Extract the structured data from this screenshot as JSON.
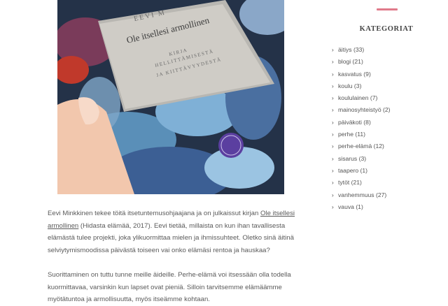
{
  "article": {
    "image": {
      "book_author": "EEVI M",
      "book_title": "Ole itsellesi armollinen",
      "book_subtitle_1": "KIRJA",
      "book_subtitle_2": "HELLITTÄMISESTÄ",
      "book_subtitle_3": "JA KIITTÄVYYDESTÄ"
    },
    "p1": {
      "before": "Eevi Minkkinen tekee töitä itsetuntemusohjaajana ja on julkaissut kirjan ",
      "link": "Ole itsellesi armollinen",
      "after": " (Hidasta elämää, 2017). Eevi tietää, millaista on kun ihan tavallisesta elämästä tulee projekti, joka ylikuormittaa mielen ja ihmissuhteet. Oletko sinä äitinä selviytymismoodissa päivästä toiseen vai onko elämäsi rentoa ja hauskaa?"
    },
    "p2": "Suorittaminen on tuttu tunne meille äideille. Perhe-elämä voi itsessään olla todella kuormittavaa, varsinkin kun lapset ovat pieniä. Silloin tarvitsemme elämäämme myötätuntoa ja armollisuutta, myös itseämme kohtaan."
  },
  "sidebar": {
    "accent_color": "#e07a8a",
    "title": "KATEGORIAT",
    "chevron": "›",
    "categories": [
      {
        "label": "äitiys (33)"
      },
      {
        "label": "blogi (21)"
      },
      {
        "label": "kasvatus (9)"
      },
      {
        "label": "koulu (3)"
      },
      {
        "label": "koululainen (7)"
      },
      {
        "label": "mainosyhteistyö (2)"
      },
      {
        "label": "päiväkoti (8)"
      },
      {
        "label": "perhe (11)"
      },
      {
        "label": "perhe-elämä (12)"
      },
      {
        "label": "sisarus (3)"
      },
      {
        "label": "taapero (1)"
      },
      {
        "label": "tytöt (21)"
      },
      {
        "label": "vanhemmuus (27)"
      },
      {
        "label": "vauva (1)"
      }
    ]
  }
}
